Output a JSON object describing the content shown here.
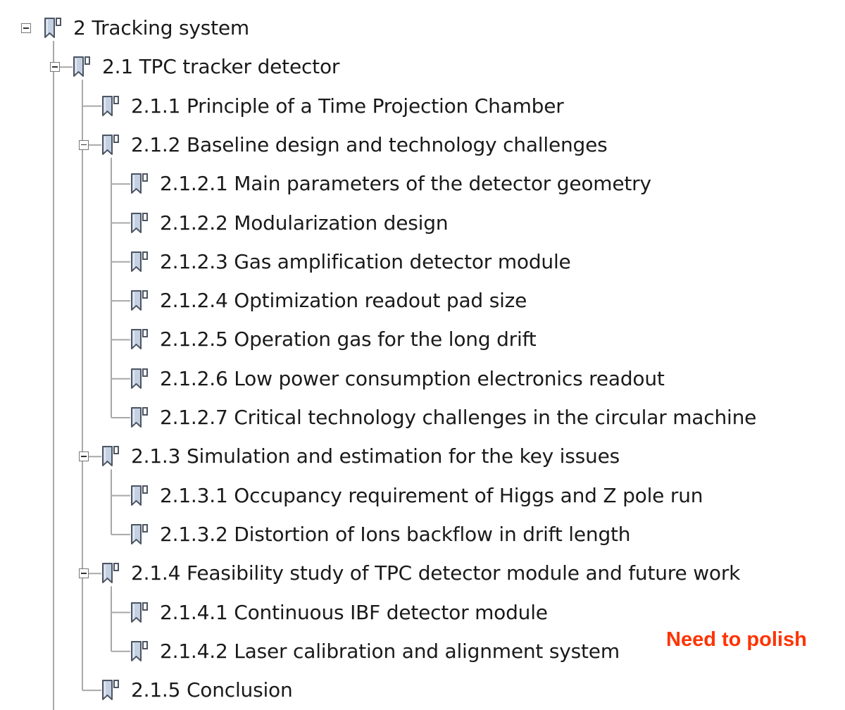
{
  "tree": {
    "items": [
      {
        "label": "2 Tracking system",
        "level": 0,
        "expanded": true
      },
      {
        "label": "2.1 TPC tracker detector",
        "level": 1,
        "expanded": true
      },
      {
        "label": "2.1.1 Principle of a Time Projection Chamber",
        "level": 2,
        "expanded": null
      },
      {
        "label": "2.1.2 Baseline design and technology challenges",
        "level": 2,
        "expanded": true
      },
      {
        "label": "2.1.2.1 Main parameters of the detector geometry",
        "level": 3,
        "expanded": null
      },
      {
        "label": "2.1.2.2 Modularization design",
        "level": 3,
        "expanded": null
      },
      {
        "label": "2.1.2.3 Gas amplification detector module",
        "level": 3,
        "expanded": null
      },
      {
        "label": "2.1.2.4 Optimization readout pad size",
        "level": 3,
        "expanded": null
      },
      {
        "label": "2.1.2.5 Operation gas for the long drift",
        "level": 3,
        "expanded": null
      },
      {
        "label": "2.1.2.6 Low power consumption electronics readout",
        "level": 3,
        "expanded": null
      },
      {
        "label": "2.1.2.7 Critical technology challenges in the circular machine",
        "level": 3,
        "expanded": null
      },
      {
        "label": "2.1.3 Simulation and estimation for the key issues",
        "level": 2,
        "expanded": true
      },
      {
        "label": "2.1.3.1 Occupancy requirement of Higgs and Z pole run",
        "level": 3,
        "expanded": null
      },
      {
        "label": "2.1.3.2 Distortion of Ions backflow in drift length",
        "level": 3,
        "expanded": null
      },
      {
        "label": "2.1.4 Feasibility study of TPC detector module and future work",
        "level": 2,
        "expanded": true
      },
      {
        "label": "2.1.4.1 Continuous IBF detector module",
        "level": 3,
        "expanded": null
      },
      {
        "label": "2.1.4.2 Laser calibration and alignment system",
        "level": 3,
        "expanded": null
      },
      {
        "label": "2.1.5 Conclusion",
        "level": 2,
        "expanded": null
      }
    ]
  },
  "annotation": {
    "text": "Need to polish",
    "color": "#ff3300"
  },
  "icons": {
    "bookmark": "bookmark-icon",
    "toggle": "collapse-toggle-icon"
  },
  "colors": {
    "tree_line": "#a8a8a8",
    "bookmark_fill": "#c4d1e3",
    "bookmark_stroke": "#4d5563",
    "text": "#1a1a1a"
  }
}
